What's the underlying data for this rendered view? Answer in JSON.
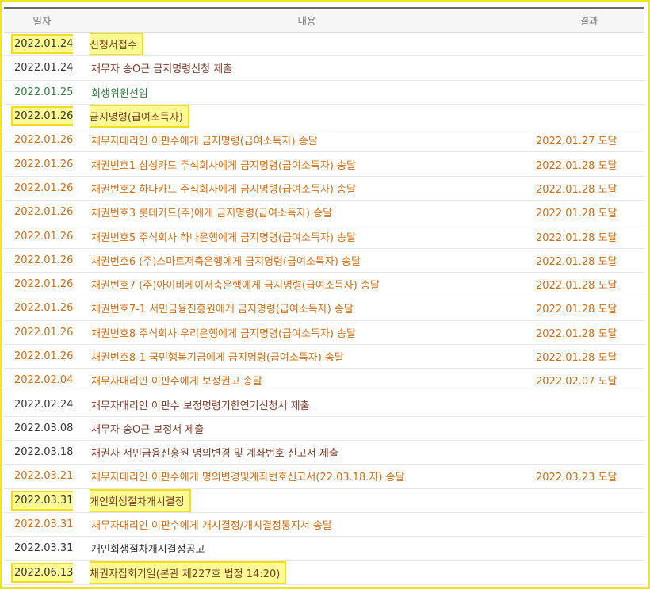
{
  "headers": {
    "date": "일자",
    "content": "내용",
    "result": "결과"
  },
  "colors": {
    "brown": "#7a3b27",
    "orange": "#cf6c0e",
    "green": "#2f7c3c",
    "black": "#333333",
    "highlight": "#fffb94",
    "highlight_border": "#f0dd1c"
  },
  "rows": [
    {
      "date": "2022.01.24",
      "content": "신청서접수",
      "result": "",
      "color": "#333333",
      "content_color": "#7a3b27",
      "highlight": true
    },
    {
      "date": "2022.01.24",
      "content": "채무자 송O근 금지명령신청 제출",
      "result": "",
      "color": "#333333",
      "content_color": "#7a3b27",
      "highlight": false
    },
    {
      "date": "2022.01.25",
      "content": "회생위원선임",
      "result": "",
      "color": "#2f7c3c",
      "content_color": "#2f7c3c",
      "highlight": false
    },
    {
      "date": "2022.01.26",
      "content": "금지명령(급여소득자)",
      "result": "",
      "color": "#333333",
      "content_color": "#7a3b27",
      "highlight": true
    },
    {
      "date": "2022.01.26",
      "content": "채무자대리인 이판수에게 금지명령(급여소득자) 송달",
      "result": "2022.01.27 도달",
      "color": "#cf6c0e",
      "content_color": "#cf6c0e",
      "highlight": false
    },
    {
      "date": "2022.01.26",
      "content": "채권번호1 삼성카드 주식회사에게 금지명령(급여소득자) 송달",
      "result": "2022.01.28 도달",
      "color": "#cf6c0e",
      "content_color": "#cf6c0e",
      "highlight": false
    },
    {
      "date": "2022.01.26",
      "content": "채권번호2 하나카드 주식회사에게 금지명령(급여소득자) 송달",
      "result": "2022.01.28 도달",
      "color": "#cf6c0e",
      "content_color": "#cf6c0e",
      "highlight": false
    },
    {
      "date": "2022.01.26",
      "content": "채권번호3 롯데카드(주)에게 금지명령(급여소득자) 송달",
      "result": "2022.01.28 도달",
      "color": "#cf6c0e",
      "content_color": "#cf6c0e",
      "highlight": false
    },
    {
      "date": "2022.01.26",
      "content": "채권번호5 주식회사 하나은행에게 금지명령(급여소득자) 송달",
      "result": "2022.01.28 도달",
      "color": "#cf6c0e",
      "content_color": "#cf6c0e",
      "highlight": false
    },
    {
      "date": "2022.01.26",
      "content": "채권번호6 (주)스마트저축은행에게 금지명령(급여소득자) 송달",
      "result": "2022.01.28 도달",
      "color": "#cf6c0e",
      "content_color": "#cf6c0e",
      "highlight": false
    },
    {
      "date": "2022.01.26",
      "content": "채권번호7 (주)아이비케이저축은행에게 금지명령(급여소득자) 송달",
      "result": "2022.01.28 도달",
      "color": "#cf6c0e",
      "content_color": "#cf6c0e",
      "highlight": false
    },
    {
      "date": "2022.01.26",
      "content": "채권번호7-1 서민금융진흥원에게 금지명령(급여소득자) 송달",
      "result": "2022.01.28 도달",
      "color": "#cf6c0e",
      "content_color": "#cf6c0e",
      "highlight": false
    },
    {
      "date": "2022.01.26",
      "content": "채권번호8 주식회사 우리은행에게 금지명령(급여소득자) 송달",
      "result": "2022.01.28 도달",
      "color": "#cf6c0e",
      "content_color": "#cf6c0e",
      "highlight": false
    },
    {
      "date": "2022.01.26",
      "content": "채권번호8-1 국민행복기금에게 금지명령(급여소득자) 송달",
      "result": "2022.01.28 도달",
      "color": "#cf6c0e",
      "content_color": "#cf6c0e",
      "highlight": false
    },
    {
      "date": "2022.02.04",
      "content": "채무자대리인 이판수에게 보정권고 송달",
      "result": "2022.02.07 도달",
      "color": "#cf6c0e",
      "content_color": "#cf6c0e",
      "highlight": false
    },
    {
      "date": "2022.02.24",
      "content": "채무자대리인 이판수 보정명령기한연기신청서 제출",
      "result": "",
      "color": "#333333",
      "content_color": "#7a3b27",
      "highlight": false
    },
    {
      "date": "2022.03.08",
      "content": "채무자 송O근 보정서 제출",
      "result": "",
      "color": "#333333",
      "content_color": "#7a3b27",
      "highlight": false
    },
    {
      "date": "2022.03.18",
      "content": "채권자 서민금융진흥원 명의변경 및 계좌번호 신고서 제출",
      "result": "",
      "color": "#333333",
      "content_color": "#7a3b27",
      "highlight": false
    },
    {
      "date": "2022.03.21",
      "content": "채무자대리인 이판수에게 명의변경및계좌번호신고서(22.03.18.자) 송달",
      "result": "2022.03.23 도달",
      "color": "#cf6c0e",
      "content_color": "#cf6c0e",
      "highlight": false
    },
    {
      "date": "2022.03.31",
      "content": "개인회생절차개시결정",
      "result": "",
      "color": "#333333",
      "content_color": "#7a3b27",
      "highlight": true
    },
    {
      "date": "2022.03.31",
      "content": "채무자대리인 이판수에게 개시결정/개시결정통지서 송달",
      "result": "",
      "color": "#cf6c0e",
      "content_color": "#cf6c0e",
      "highlight": false
    },
    {
      "date": "2022.03.31",
      "content": "개인회생절차개시결정공고",
      "result": "",
      "color": "#333333",
      "content_color": "#333333",
      "highlight": false
    },
    {
      "date": "2022.06.13",
      "content": "채권자집회기일(본관 제227호 법정 14:20)",
      "result": "",
      "color": "#333333",
      "content_color": "#7a3b27",
      "highlight": true
    }
  ]
}
